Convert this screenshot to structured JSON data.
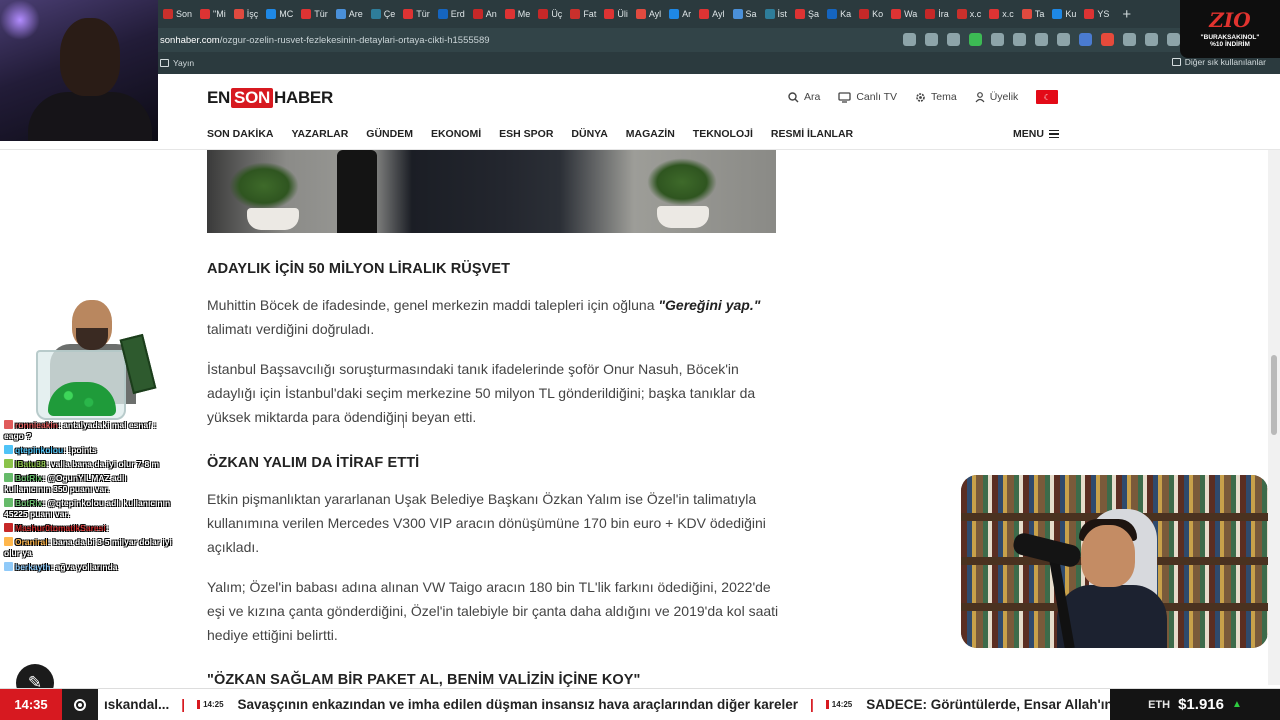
{
  "browser": {
    "tabs": [
      "Son",
      "\"Mi",
      "İşç",
      "MC",
      "Tür",
      "Are",
      "Çe",
      "Tür",
      "Erd",
      "An",
      "Me",
      "Üç",
      "Fat",
      "Üli",
      "Ayl",
      "Ar",
      "Ayl",
      "Sa",
      "İst",
      "Şa",
      "Ka",
      "Ko",
      "Wa",
      "İra",
      "x.c",
      "x.c",
      "Ta",
      "Ku",
      "YS"
    ],
    "new_tab": "+",
    "url_domain": "sonhaber.com",
    "url_path": "/ozgur-ozelin-rusvet-fezlekesinin-detaylari-ortaya-cikti-h1555589",
    "bookmark_left": "Yayın",
    "bookmark_right": "Diğer sık kullanılanlar"
  },
  "site": {
    "logo": {
      "part1": "EN",
      "part2": "SON",
      "part3": "HABER"
    },
    "tools": {
      "search": "Ara",
      "live_tv": "Canlı TV",
      "theme": "Tema",
      "member": "Üyelik"
    },
    "nav": [
      "SON DAKİKA",
      "YAZARLAR",
      "GÜNDEM",
      "EKONOMİ",
      "ESH SPOR",
      "DÜNYA",
      "MAGAZİN",
      "TEKNOLOJİ",
      "RESMİ İLANLAR"
    ],
    "menu": "MENU"
  },
  "article": {
    "h_1": "ADAYLIK İÇİN 50 MİLYON LİRALIK RÜŞVET",
    "p_1a": "Muhittin Böcek de ifadesinde, genel merkezin maddi talepleri için oğluna ",
    "p_1b": "\"Gereğini yap.\"",
    "p_1c": " talimatı verdiğini doğruladı.",
    "p_2": "İstanbul Başsavcılığı soruşturmasındaki tanık ifadelerinde şoför Onur Nasuh, Böcek'in adaylığı için İstanbul'daki seçim merkezine 50 milyon TL gönderildiğini; başka tanıklar da yüksek miktarda para ödendiğini beyan etti.",
    "h_2": "ÖZKAN YALIM DA İTİRAF ETTİ",
    "p_3": "Etkin pişmanlıktan yararlanan Uşak Belediye Başkanı Özkan Yalım ise Özel'in talimatıyla kullanımına verilen Mercedes V300 VIP aracın dönüşümüne 170 bin euro + KDV ödediğini açıkladı.",
    "p_4": "Yalım; Özel'in babası adına alınan VW Taigo aracın 180 bin TL'lik farkını ödediğini, 2022'de eşi ve kızına çanta gönderdiğini, Özel'in talebiyle bir çanta daha aldığını ve 2019'da kol saati hediye ettiğini belirtti.",
    "h_3": "\"ÖZKAN SAĞLAM BİR PAKET AL, BENİM VALİZİN İÇİNE KOY\""
  },
  "promo": {
    "brand": "ZIO",
    "code": "\"BURAKSAKINOL\"",
    "discount": "%10 İNDİRİM"
  },
  "chat": [
    {
      "user": "ronnieakin",
      "text": ": antalyadaki mal esnaf : eago ?",
      "color": "#e05a5a"
    },
    {
      "user": "qtepinkolou",
      "text": ": !points",
      "color": "#4fc3f7"
    },
    {
      "user": "IBatu38",
      "text": ": valla bana da iyi olur 7-8 m",
      "color": "#8bc34a"
    },
    {
      "user": "BotRix",
      "text": ": @OgunYILMAZ adlı kullanıcının 350 puanı var.",
      "color": "#66bb6a"
    },
    {
      "user": "BotRix",
      "text": ": @qtepinkolou adlı kullanıcının 45225 puanı var.",
      "color": "#66bb6a"
    },
    {
      "user": "Mashur0tomatikSaresi",
      "text": ":",
      "color": "#c62828"
    },
    {
      "user": "Oraniral",
      "text": ": bana da bi 3-5 milyar dolar iyi olur ya",
      "color": "#ffb74d"
    },
    {
      "user": "berkayth",
      "text": ": ağva yollarında",
      "color": "#90caf9"
    }
  ],
  "ticker": {
    "time": "14:35",
    "item_1": "ıskandal...",
    "stamp_1": "14:25",
    "item_2": "Savaşçının enkazından ve imha edilen düşman insansız hava araçlarından diğer kareler",
    "stamp_2": "14:25",
    "item_3": "SADECE: Görüntülerde, Ensar Allah'ın",
    "sep": "|",
    "eth_label": "ETH",
    "eth_value": "$1.916",
    "eth_arrow": "▲"
  },
  "colors": {
    "brand_red": "#d71920",
    "chrome": "#2b3a3e"
  }
}
